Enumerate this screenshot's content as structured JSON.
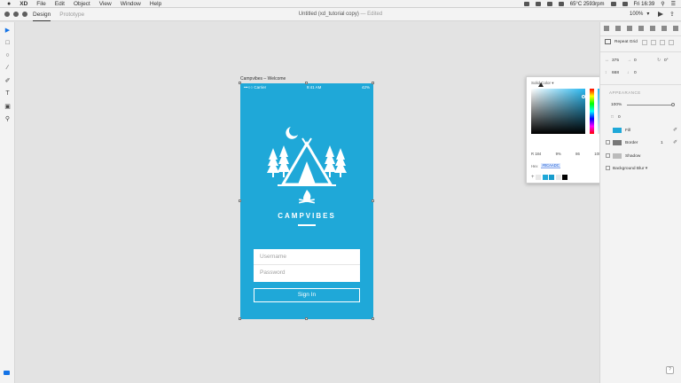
{
  "menubar": {
    "apple": "",
    "app_name": "XD",
    "menus": [
      "File",
      "Edit",
      "Object",
      "View",
      "Window",
      "Help"
    ],
    "status": {
      "temp": "65°C 2593rpm",
      "clock": "Fri 16:39"
    }
  },
  "titlebar": {
    "tabs": [
      "Design",
      "Prototype"
    ],
    "document_title": "Untitled (xd_tutorial copy)",
    "edited": "— Edited",
    "zoom": "100%"
  },
  "artboard": {
    "label": "Campvibes – Welcome",
    "status_carrier": "•••○○ Carrier",
    "status_time": "9:41 AM",
    "status_battery": "42%",
    "brand": "CAMPVIBES",
    "username_placeholder": "Username",
    "password_placeholder": "Password",
    "signin_label": "Sign In"
  },
  "color_picker": {
    "mode": "Solid Color",
    "values": [
      {
        "label": "R",
        "value": "184"
      },
      {
        "label": "",
        "value": "9%"
      },
      {
        "label": "",
        "value": "86"
      },
      {
        "label": "",
        "value": "100%"
      }
    ],
    "hex_label": "Hex",
    "hex_value": "#0CAADC",
    "swatches": [
      "#e8e8e8",
      "#1fa8d8",
      "#189ccc",
      "#e8e8e8",
      "#000000"
    ]
  },
  "right_panel": {
    "repeat_grid": "Repeat Grid",
    "w": "375",
    "x": "0",
    "rotation": "0°",
    "h": "668",
    "y": "0",
    "appearance_label": "APPEARANCE",
    "opacity": "100%",
    "corner": "0",
    "fill_label": "Fill",
    "border_label": "Border",
    "border_width": "1",
    "shadow_label": "Shadow",
    "bg_blur_label": "Background Blur"
  },
  "colors": {
    "artboard": "#1fa8d8",
    "accent": "#1473e6"
  }
}
